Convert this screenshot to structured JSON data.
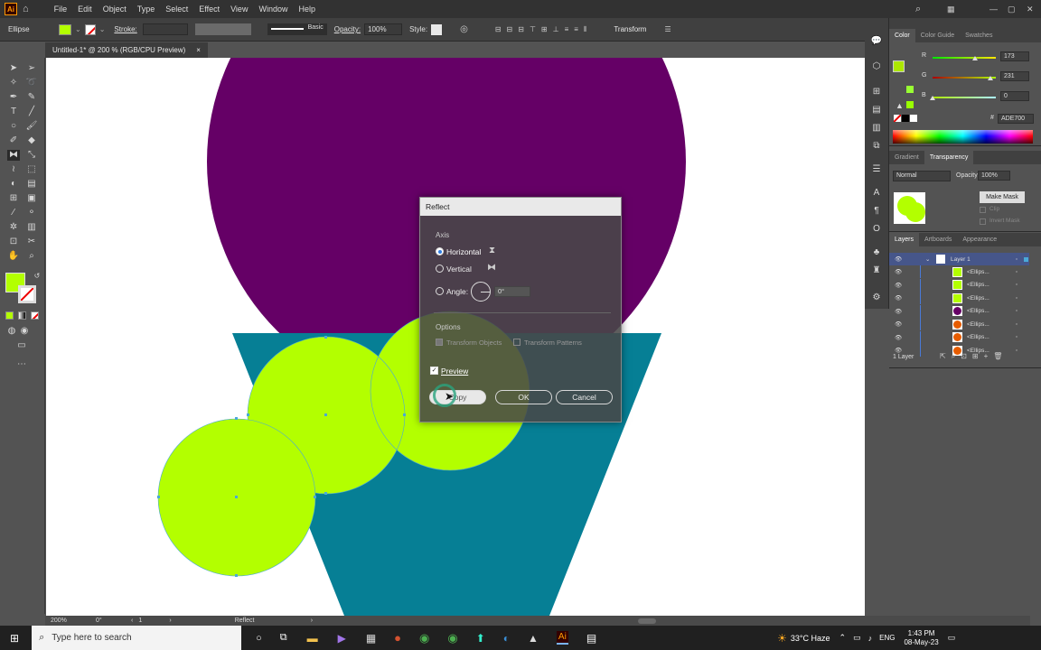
{
  "menubar": {
    "logo": "Ai",
    "items": [
      "File",
      "Edit",
      "Object",
      "Type",
      "Select",
      "Effect",
      "View",
      "Window",
      "Help"
    ]
  },
  "controlbar": {
    "object_type": "Ellipse",
    "stroke_label": "Stroke:",
    "brush": "Basic",
    "opacity_label": "Opacity:",
    "opacity_value": "100%",
    "style_label": "Style:",
    "transform_label": "Transform",
    "fill_color": "#b3ff00"
  },
  "document": {
    "tab_title": "Untitled-1* @ 200 % (RGB/CPU Preview)",
    "close": "×"
  },
  "status": {
    "zoom": "200%",
    "rotation": "0°",
    "artboard": "1",
    "tool": "Reflect"
  },
  "dialog": {
    "title": "Reflect",
    "axis_label": "Axis",
    "horizontal_label": "Horizontal",
    "vertical_label": "Vertical",
    "angle_label": "Angle:",
    "angle_value": "0°",
    "options_label": "Options",
    "transform_objects": "Transform Objects",
    "transform_patterns": "Transform Patterns",
    "preview_label": "Preview",
    "copy_button": "Copy",
    "ok_button": "OK",
    "cancel_button": "Cancel"
  },
  "color_panel": {
    "tabs": [
      "Color",
      "Color Guide",
      "Swatches"
    ],
    "r_label": "R",
    "r_value": "173",
    "g_label": "G",
    "g_value": "231",
    "b_label": "B",
    "b_value": "0",
    "r": 173,
    "g": 231,
    "b": 0,
    "hex_label": "#",
    "hex_value": "ADE700"
  },
  "transparency_panel": {
    "tabs": [
      "Gradient",
      "Transparency"
    ],
    "blend_mode": "Normal",
    "opacity_label": "Opacity:",
    "opacity_value": "100%",
    "make_mask": "Make Mask",
    "clip": "Clip",
    "invert_mask": "Invert Mask"
  },
  "layers_panel": {
    "tabs": [
      "Layers",
      "Artboards",
      "Appearance"
    ],
    "layer_name": "Layer 1",
    "rows": [
      {
        "name": "<Ellips...",
        "color": "#b3ff00"
      },
      {
        "name": "<Ellips...",
        "color": "#b3ff00"
      },
      {
        "name": "<Ellips...",
        "color": "#b3ff00"
      },
      {
        "name": "<Ellips...",
        "color": "#660066"
      },
      {
        "name": "<Ellips...",
        "color": "#e65c00"
      },
      {
        "name": "<Ellips...",
        "color": "#e65c00"
      },
      {
        "name": "<Ellips...",
        "color": "#e65c00"
      }
    ],
    "footer": "1 Layer"
  },
  "taskbar": {
    "search_placeholder": "Type here to search",
    "weather": "33°C  Haze",
    "lang": "ENG",
    "time": "1:43 PM",
    "date": "08-May-23"
  },
  "artwork_colors": {
    "purple": "#650066",
    "teal": "#067f95",
    "lime": "#b3ff00"
  }
}
